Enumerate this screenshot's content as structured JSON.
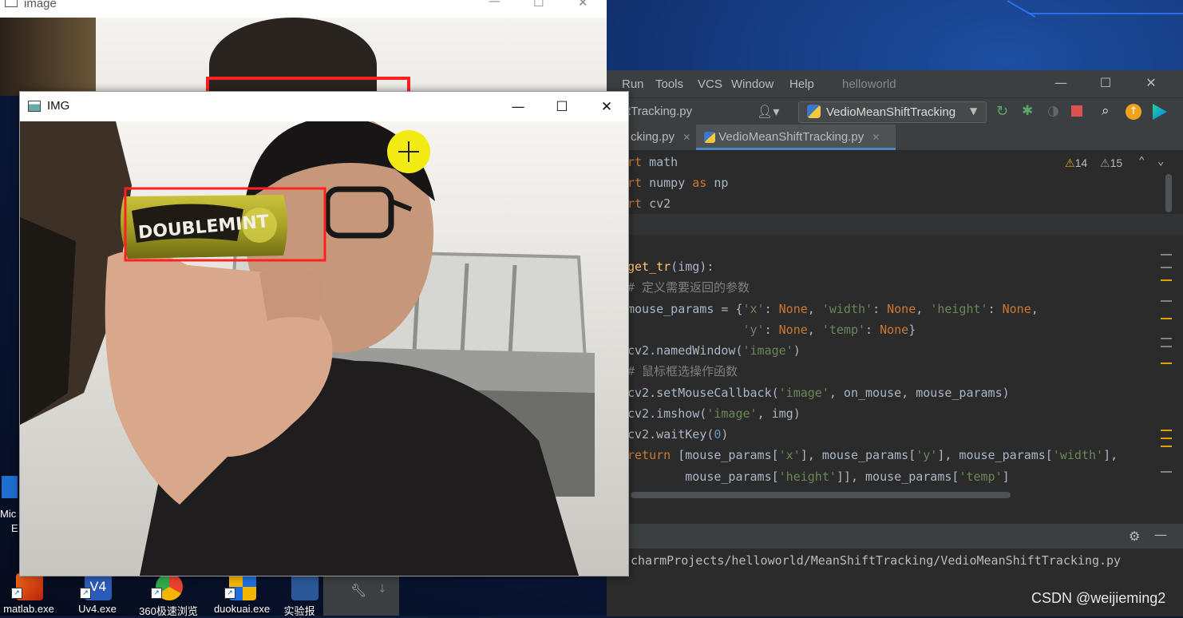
{
  "ide": {
    "menus": [
      "Run",
      "Tools",
      "VCS",
      "Window",
      "Help"
    ],
    "project_name": "helloworld",
    "nav_file": "tTracking.py",
    "run_config": "VedioMeanShiftTracking",
    "tabs": [
      {
        "label": "cking.py",
        "active": false
      },
      {
        "label": "VedioMeanShiftTracking.py",
        "active": true
      }
    ],
    "warnings_count": "14",
    "weak_warnings_count": "15",
    "code_lines": [
      "rt math",
      "rt numpy as np",
      "rt cv2",
      "",
      "",
      "get_tr(img):",
      "# 定义需要返回的参数",
      "mouse_params = {'x': None, 'width': None, 'height': None,",
      "                'y': None, 'temp': None}",
      "cv2.namedWindow('image')",
      "# 鼠标框选操作函数",
      "cv2.setMouseCallback('image', on_mouse, mouse_params)",
      "cv2.imshow('image', img)",
      "cv2.waitKey(0)",
      "return [mouse_params['x'], mouse_params['y'], mouse_params['width'],",
      "        mouse_params['height']], mouse_params['temp']"
    ],
    "run_path": "charmProjects/helloworld/MeanShiftTracking/VedioMeanShiftTracking.py"
  },
  "windows": {
    "image_title": "image",
    "img_title": "IMG",
    "gum_brand": "DOUBLEMINT"
  },
  "desktop": {
    "icons": [
      {
        "label": "matlab.exe"
      },
      {
        "label": "Uv4.exe"
      },
      {
        "label": "360极速浏览"
      },
      {
        "label": "duokuai.exe"
      },
      {
        "label": "实验报"
      }
    ],
    "side_labels": [
      "Mic",
      "E"
    ]
  },
  "watermark": "CSDN @weijieming2",
  "colors": {
    "ide_bg": "#2b2b2b",
    "keyword": "#cc7832",
    "string": "#6a8759",
    "function": "#ffc66d",
    "number": "#6897bb",
    "selection_box": "#ff2020",
    "cursor_highlight": "#f2ea13"
  }
}
